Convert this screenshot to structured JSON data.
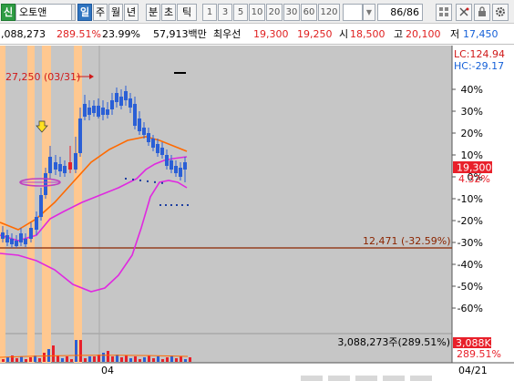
{
  "toolbar": {
    "market_badge": "신",
    "stock_name": "오토앤",
    "period_active": "일",
    "periods": [
      "주",
      "월",
      "년",
      "분",
      "초",
      "틱"
    ],
    "intervals": [
      "1",
      "3",
      "5",
      "10",
      "20",
      "30",
      "60",
      "120"
    ],
    "page": "86",
    "page_total": "/86",
    "icons": [
      "grid-icon",
      "scissors-icon",
      "lock-icon",
      "gear-icon"
    ]
  },
  "info": {
    "volume": ",088,273",
    "volume_change": "289.51%",
    "turnover": "23.99%",
    "value": "57,913백만",
    "best_bid_label": "최우선",
    "ask": "19,300",
    "bid": "19,250",
    "open_label": "시",
    "open": "18,500",
    "high_label": "고",
    "high": "20,100",
    "low_label": "저",
    "low": "17,450"
  },
  "chart": {
    "max_label": "27,250 (03/31)",
    "lc_label": "LC:124.94",
    "hc_label": "HC:-29.17",
    "support_label": "12,471 (-32.59%)",
    "price_tag": "19,300",
    "price_change": "4.32%",
    "volume_info": "3,088,273주(289.51%)",
    "volume_tag": "3,088K",
    "volume_change": "289.51%",
    "x_label": "04",
    "x_label_end": "04/21"
  },
  "chart_data": {
    "type": "candlestick",
    "y_axis_labels": [
      "40%",
      "30%",
      "20%",
      "10%",
      "0%",
      "-10%",
      "-20%",
      "-30%",
      "-40%",
      "-50%",
      "-60%"
    ],
    "current_price": 19300,
    "change_pct": 4.32,
    "high_marker": {
      "price": 27250,
      "date": "03/31"
    },
    "support_line": {
      "price": 12471,
      "pct": -32.59
    },
    "volume": 3088273,
    "volume_change_pct": 289.51,
    "colors": {
      "up": "#e8202a",
      "down": "#2a5fd6",
      "ma": "#ff6a00",
      "envelope": "#e028e0",
      "support": "#8b2500",
      "highlight": "#ffc890"
    }
  }
}
